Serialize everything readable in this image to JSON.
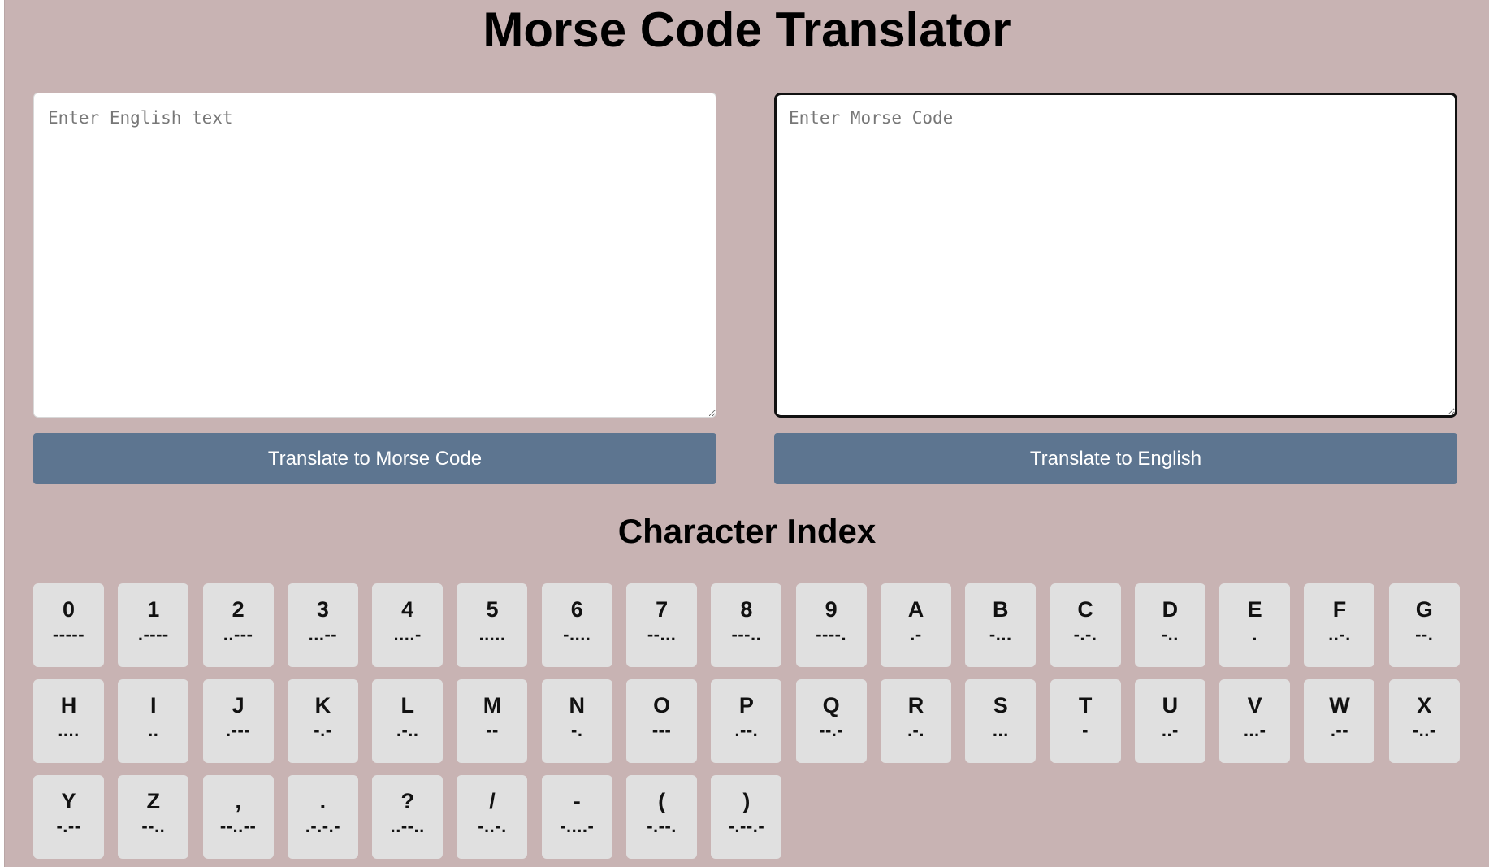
{
  "title": "Morse Code Translator",
  "english_panel": {
    "placeholder": "Enter English text",
    "value": "",
    "button_label": "Translate to Morse Code"
  },
  "morse_panel": {
    "placeholder": "Enter Morse Code",
    "value": "",
    "button_label": "Translate to English"
  },
  "index_title": "Character Index",
  "characters": [
    {
      "char": "0",
      "code": "-----"
    },
    {
      "char": "1",
      "code": ".----"
    },
    {
      "char": "2",
      "code": "..---"
    },
    {
      "char": "3",
      "code": "...--"
    },
    {
      "char": "4",
      "code": "....-"
    },
    {
      "char": "5",
      "code": "....."
    },
    {
      "char": "6",
      "code": "-...."
    },
    {
      "char": "7",
      "code": "--..."
    },
    {
      "char": "8",
      "code": "---.."
    },
    {
      "char": "9",
      "code": "----."
    },
    {
      "char": "A",
      "code": ".-"
    },
    {
      "char": "B",
      "code": "-..."
    },
    {
      "char": "C",
      "code": "-.-."
    },
    {
      "char": "D",
      "code": "-.."
    },
    {
      "char": "E",
      "code": "."
    },
    {
      "char": "F",
      "code": "..-."
    },
    {
      "char": "G",
      "code": "--."
    },
    {
      "char": "H",
      "code": "...."
    },
    {
      "char": "I",
      "code": ".."
    },
    {
      "char": "J",
      "code": ".---"
    },
    {
      "char": "K",
      "code": "-.-"
    },
    {
      "char": "L",
      "code": ".-.."
    },
    {
      "char": "M",
      "code": "--"
    },
    {
      "char": "N",
      "code": "-."
    },
    {
      "char": "O",
      "code": "---"
    },
    {
      "char": "P",
      "code": ".--."
    },
    {
      "char": "Q",
      "code": "--.-"
    },
    {
      "char": "R",
      "code": ".-."
    },
    {
      "char": "S",
      "code": "..."
    },
    {
      "char": "T",
      "code": "-"
    },
    {
      "char": "U",
      "code": "..-"
    },
    {
      "char": "V",
      "code": "...-"
    },
    {
      "char": "W",
      "code": ".--"
    },
    {
      "char": "X",
      "code": "-..-"
    },
    {
      "char": "Y",
      "code": "-.--"
    },
    {
      "char": "Z",
      "code": "--.."
    },
    {
      "char": ",",
      "code": "--..--"
    },
    {
      "char": ".",
      "code": ".-.-.-"
    },
    {
      "char": "?",
      "code": "..--.."
    },
    {
      "char": "/",
      "code": "-..-."
    },
    {
      "char": "-",
      "code": "-....-"
    },
    {
      "char": "(",
      "code": "-.--."
    },
    {
      "char": ")",
      "code": "-.--.-"
    }
  ]
}
